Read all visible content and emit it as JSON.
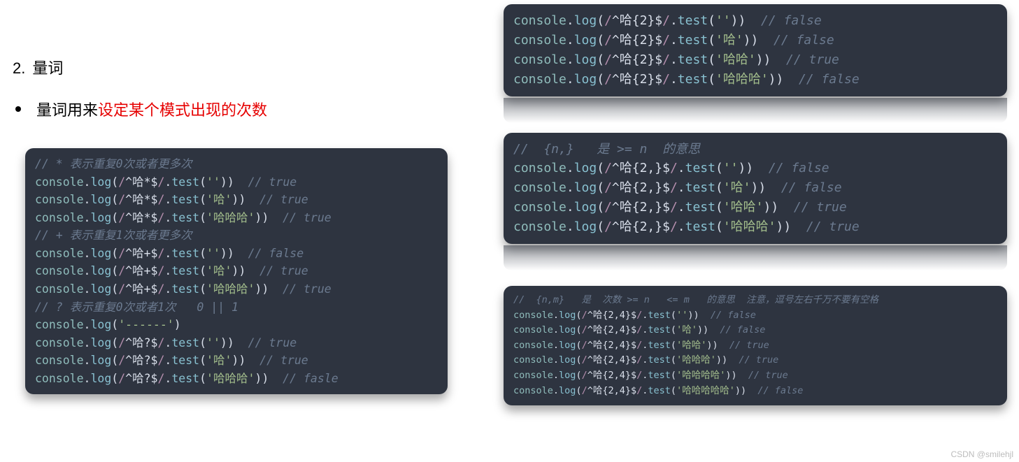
{
  "heading": {
    "number": "2.",
    "text": "量词"
  },
  "bullet": {
    "black": "量词用来 ",
    "red": "设定某个模式出现的次数"
  },
  "block1": {
    "c1": "// * 表示重复0次或者更多次",
    "l1": {
      "obj": "console",
      "method": "log",
      "regex": "^哈*$",
      "test": "test",
      "arg": "''",
      "comment": "// true"
    },
    "l2": {
      "obj": "console",
      "method": "log",
      "regex": "^哈*$",
      "test": "test",
      "arg": "'哈'",
      "comment": "// true"
    },
    "l3": {
      "obj": "console",
      "method": "log",
      "regex": "^哈*$",
      "test": "test",
      "arg": "'哈哈哈'",
      "comment": "// true"
    },
    "c2": "// + 表示重复1次或者更多次",
    "l4": {
      "obj": "console",
      "method": "log",
      "regex": "^哈+$",
      "test": "test",
      "arg": "''",
      "comment": "// false"
    },
    "l5": {
      "obj": "console",
      "method": "log",
      "regex": "^哈+$",
      "test": "test",
      "arg": "'哈'",
      "comment": "// true"
    },
    "l6": {
      "obj": "console",
      "method": "log",
      "regex": "^哈+$",
      "test": "test",
      "arg": "'哈哈哈'",
      "comment": "// true"
    },
    "c3": "// ? 表示重复0次或者1次   0 || 1",
    "l7": {
      "obj": "console",
      "method": "log",
      "arg": "'------'"
    },
    "l8": {
      "obj": "console",
      "method": "log",
      "regex": "^哈?$",
      "test": "test",
      "arg": "''",
      "comment": "// true"
    },
    "l9": {
      "obj": "console",
      "method": "log",
      "regex": "^哈?$",
      "test": "test",
      "arg": "'哈'",
      "comment": "// true"
    },
    "l10": {
      "obj": "console",
      "method": "log",
      "regex": "^哈?$",
      "test": "test",
      "arg": "'哈哈哈'",
      "comment": "// fasle"
    }
  },
  "block2": {
    "l1": {
      "obj": "console",
      "method": "log",
      "regex": "^哈{2}$",
      "test": "test",
      "arg": "''",
      "comment": "// false"
    },
    "l2": {
      "obj": "console",
      "method": "log",
      "regex": "^哈{2}$",
      "test": "test",
      "arg": "'哈'",
      "comment": "// false"
    },
    "l3": {
      "obj": "console",
      "method": "log",
      "regex": "^哈{2}$",
      "test": "test",
      "arg": "'哈哈'",
      "comment": "// true"
    },
    "l4": {
      "obj": "console",
      "method": "log",
      "regex": "^哈{2}$",
      "test": "test",
      "arg": "'哈哈哈'",
      "comment": "// false"
    }
  },
  "block3": {
    "c1": "//  {n,}   是 >= n  的意思",
    "l1": {
      "obj": "console",
      "method": "log",
      "regex": "^哈{2,}$",
      "test": "test",
      "arg": "''",
      "comment": "// false"
    },
    "l2": {
      "obj": "console",
      "method": "log",
      "regex": "^哈{2,}$",
      "test": "test",
      "arg": "'哈'",
      "comment": "// false"
    },
    "l3": {
      "obj": "console",
      "method": "log",
      "regex": "^哈{2,}$",
      "test": "test",
      "arg": "'哈哈'",
      "comment": "// true"
    },
    "l4": {
      "obj": "console",
      "method": "log",
      "regex": "^哈{2,}$",
      "test": "test",
      "arg": "'哈哈哈'",
      "comment": "// true"
    }
  },
  "block4": {
    "c1": "//  {n,m}   是  次数 >= n   <= m   的意思  注意，逗号左右千万不要有空格",
    "l1": {
      "obj": "console",
      "method": "log",
      "regex": "^哈{2,4}$",
      "test": "test",
      "arg": "''",
      "comment": "// false"
    },
    "l2": {
      "obj": "console",
      "method": "log",
      "regex": "^哈{2,4}$",
      "test": "test",
      "arg": "'哈'",
      "comment": "// false"
    },
    "l3": {
      "obj": "console",
      "method": "log",
      "regex": "^哈{2,4}$",
      "test": "test",
      "arg": "'哈哈'",
      "comment": "// true"
    },
    "l4": {
      "obj": "console",
      "method": "log",
      "regex": "^哈{2,4}$",
      "test": "test",
      "arg": "'哈哈哈'",
      "comment": "// true"
    },
    "l5": {
      "obj": "console",
      "method": "log",
      "regex": "^哈{2,4}$",
      "test": "test",
      "arg": "'哈哈哈哈'",
      "comment": "// true"
    },
    "l6": {
      "obj": "console",
      "method": "log",
      "regex": "^哈{2,4}$",
      "test": "test",
      "arg": "'哈哈哈哈哈'",
      "comment": "// false"
    }
  },
  "watermark": "CSDN @smilehjl"
}
